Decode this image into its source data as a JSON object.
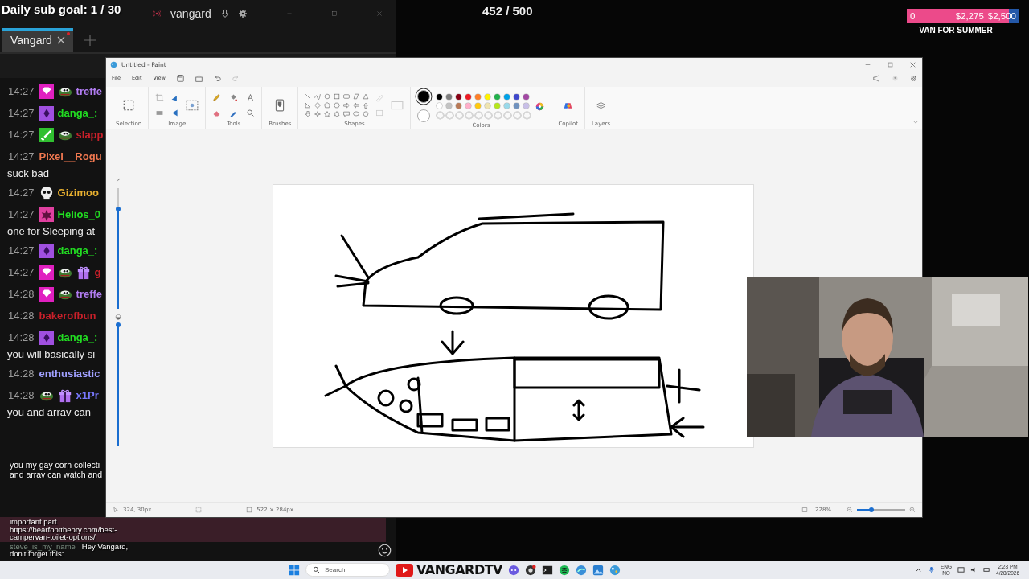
{
  "stream_overlay": {
    "sub_goal": "Daily sub goal: 1 / 30",
    "counter": "452 / 500",
    "donation_goal": {
      "start": "0",
      "current": "$2,275",
      "target": "$2,500",
      "level": 0.91,
      "title": "VAN FOR SUMMER"
    }
  },
  "chat_window": {
    "channel": "vangard",
    "tabs": [
      {
        "label": "Vangard",
        "selected": true,
        "unread": true
      }
    ],
    "messages": [
      {
        "time": "14:27",
        "badges": [
          {
            "kind": "gem"
          },
          {
            "kind": "pepe"
          }
        ],
        "user": "treffe",
        "color": "#b07cf0"
      },
      {
        "time": "14:27",
        "badges": [
          {
            "kind": "diamond"
          }
        ],
        "user": "danga_:",
        "color": "#22dd22"
      },
      {
        "time": "14:27",
        "badges": [
          {
            "kind": "sword"
          },
          {
            "kind": "pepe"
          }
        ],
        "user": "slapp",
        "color": "#c8202a"
      },
      {
        "time": "14:27",
        "user": "Pixel__Rogu",
        "color": "#f07850",
        "text": "suck bad"
      },
      {
        "time": "14:27",
        "badges": [
          {
            "kind": "skull"
          }
        ],
        "user": "Gizimoo",
        "color": "#e8b030"
      },
      {
        "time": "14:27",
        "badges": [
          {
            "kind": "star"
          }
        ],
        "user": "Helios_0",
        "color": "#22dd22",
        "text": "one for Sleeping at"
      },
      {
        "time": "14:27",
        "badges": [
          {
            "kind": "diamond"
          }
        ],
        "user": "danga_:",
        "color": "#22dd22"
      },
      {
        "time": "14:27",
        "badges": [
          {
            "kind": "gem"
          },
          {
            "kind": "pepe"
          },
          {
            "kind": "gift"
          }
        ],
        "user": "g",
        "color": "#c8202a"
      },
      {
        "time": "14:28",
        "badges": [
          {
            "kind": "gem"
          },
          {
            "kind": "pepe"
          }
        ],
        "user": "treffe",
        "color": "#b07cf0"
      },
      {
        "time": "14:28",
        "user": "bakerofbun",
        "color": "#c8202a"
      },
      {
        "time": "14:28",
        "badges": [
          {
            "kind": "diamond"
          }
        ],
        "user": "danga_:",
        "color": "#22dd22",
        "text": "you will basically si"
      },
      {
        "time": "14:28",
        "user": "enthusiastic",
        "color": "#a0a0ff"
      },
      {
        "time": "14:28",
        "badges": [
          {
            "kind": "pepe"
          },
          {
            "kind": "gift"
          }
        ],
        "user": "x1Pr",
        "color": "#7878ff",
        "text": "you and arrav can"
      }
    ],
    "alert": {
      "lines": [
        "you my gay corn collecti",
        "and arrav can watch and"
      ],
      "highlight": [
        "important part",
        "https://bearfoottheory.com/best-",
        "campervan-toilet-options/"
      ],
      "sender": "steve_is_my_name",
      "message": "Hey Vangard,",
      "more": [
        "don't forget this:"
      ]
    }
  },
  "paint": {
    "title": "Untitled - Paint",
    "menu": [
      "File",
      "Edit",
      "View"
    ],
    "groups": [
      "Selection",
      "Image",
      "Tools",
      "Brushes",
      "Shapes",
      "Colors",
      "Copilot",
      "Layers"
    ],
    "current_colors": [
      {
        "color": "#000000",
        "selected": true
      },
      {
        "color": "#ffffff",
        "selected": false
      }
    ],
    "palette": [
      {
        "color": "#000000"
      },
      {
        "color": "#7f7f7f"
      },
      {
        "color": "#880015"
      },
      {
        "color": "#ed1c24"
      },
      {
        "color": "#ff7f27"
      },
      {
        "color": "#fff200"
      },
      {
        "color": "#22b14c"
      },
      {
        "color": "#00a2e8"
      },
      {
        "color": "#3f48cc"
      },
      {
        "color": "#a349a4"
      },
      {
        "color": "#ffffff"
      },
      {
        "color": "#c3c3c3"
      },
      {
        "color": "#b97a57"
      },
      {
        "color": "#ffaec9"
      },
      {
        "color": "#ffc90e"
      },
      {
        "color": "#efe4b0"
      },
      {
        "color": "#b5e61d"
      },
      {
        "color": "#99d9ea"
      },
      {
        "color": "#7092be"
      },
      {
        "color": "#c8bfe7"
      }
    ],
    "size_slider": {
      "level": 0.83
    },
    "opacity_slider": {
      "level": 1
    },
    "status": {
      "cursor": "324, 30px",
      "size": "522 × 284px",
      "zoom": "228%",
      "zoom_level": {
        "level": 0.3
      }
    }
  },
  "taskbar": {
    "search": "Search",
    "channel": "VANGARDTV",
    "language": "ENG",
    "layout": "NO",
    "time": "2:28 PM",
    "date": "4/28/2026"
  }
}
